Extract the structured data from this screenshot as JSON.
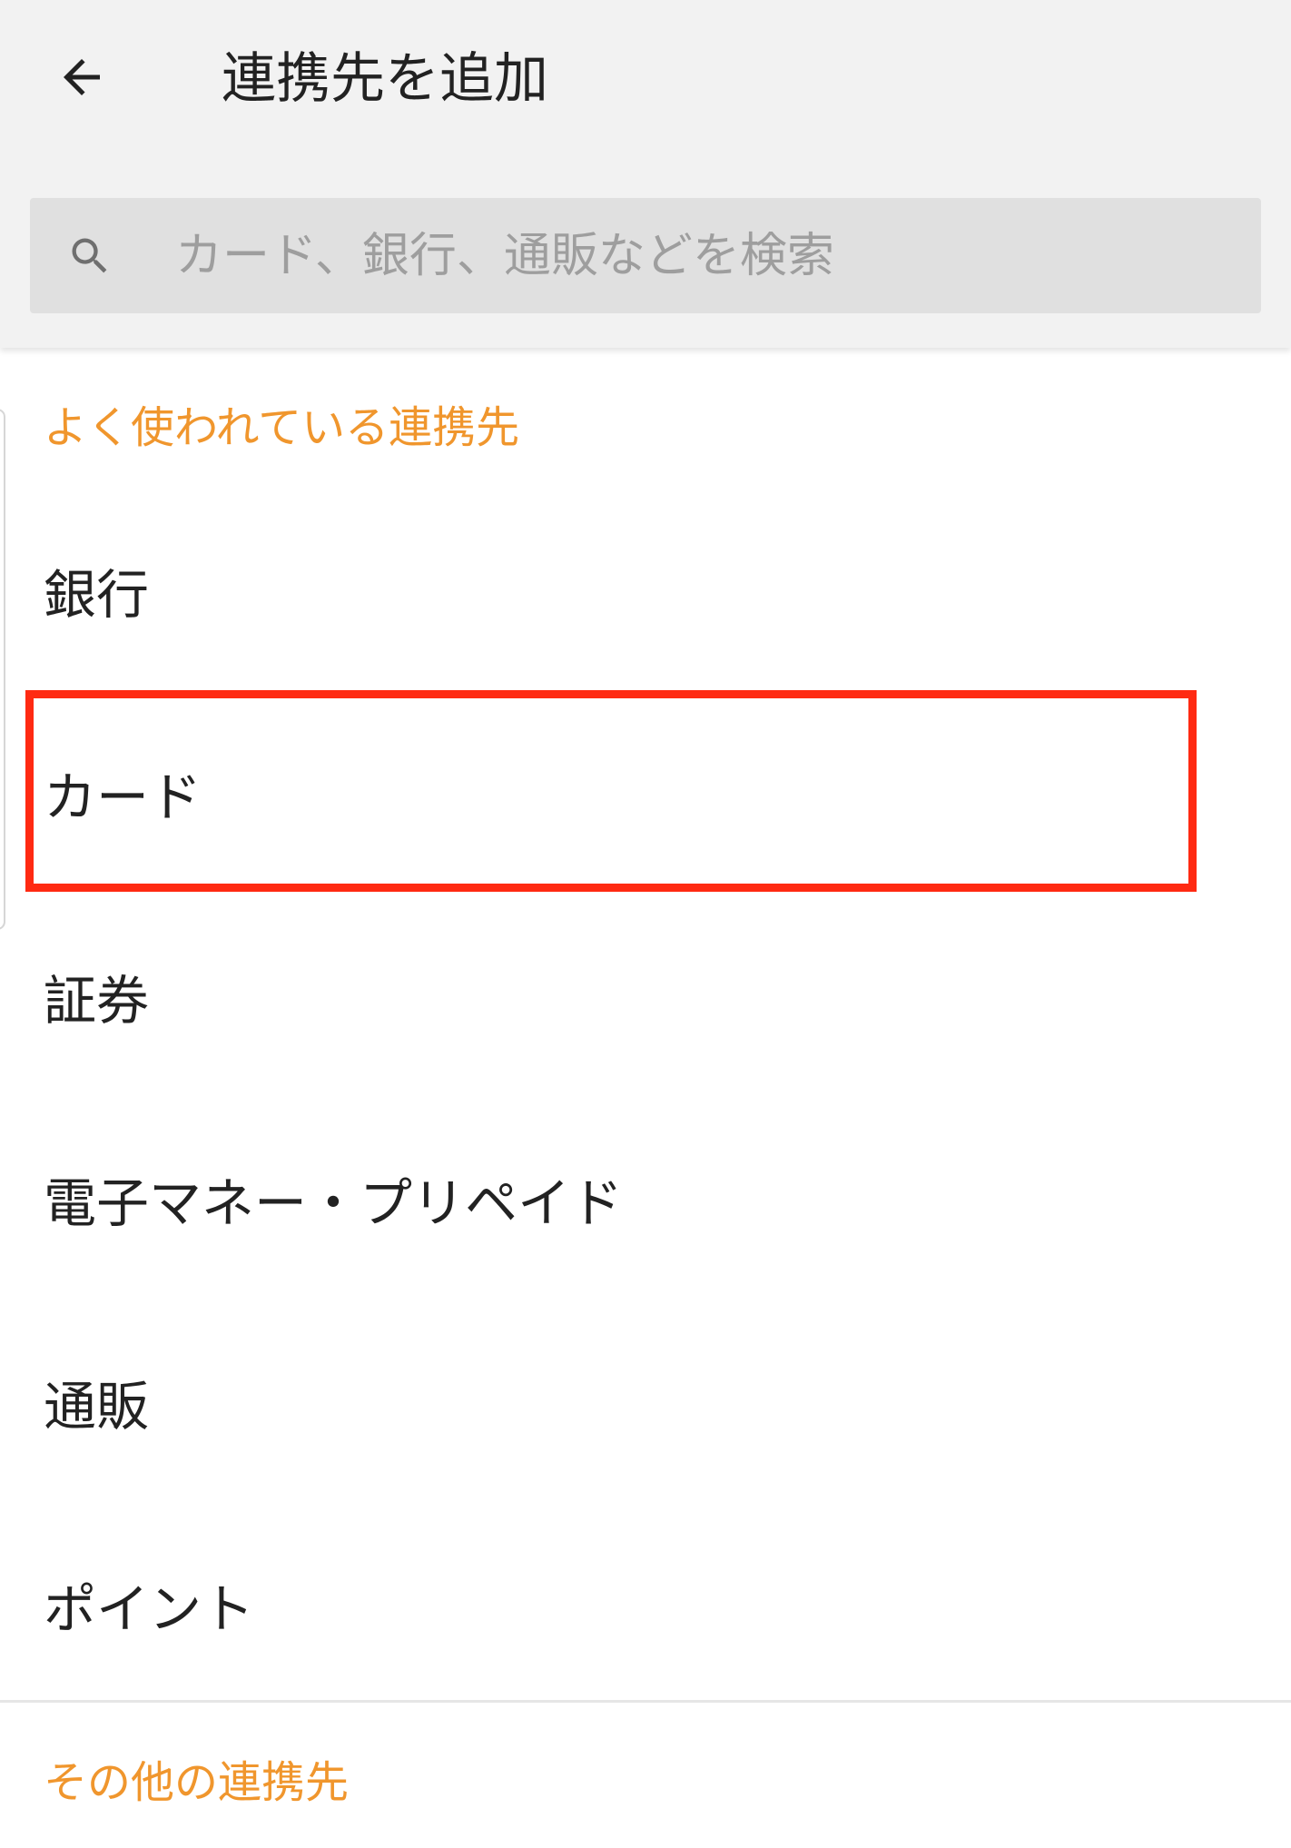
{
  "header": {
    "title": "連携先を追加",
    "back_icon": "arrow-back-icon"
  },
  "search": {
    "placeholder": "カード、銀行、通販などを検索",
    "value": "",
    "icon": "search-icon"
  },
  "sections": {
    "frequent": {
      "title": "よく使われている連携先",
      "items": [
        {
          "label": "銀行"
        },
        {
          "label": "カード"
        },
        {
          "label": "証券"
        },
        {
          "label": "電子マネー・プリペイド"
        },
        {
          "label": "通販"
        },
        {
          "label": "ポイント"
        }
      ]
    },
    "other": {
      "title": "その他の連携先"
    }
  },
  "colors": {
    "accent": "#f0962d",
    "highlight": "#ff2a12",
    "header_bg": "#f2f2f2",
    "search_bg": "#e0e0e0"
  }
}
